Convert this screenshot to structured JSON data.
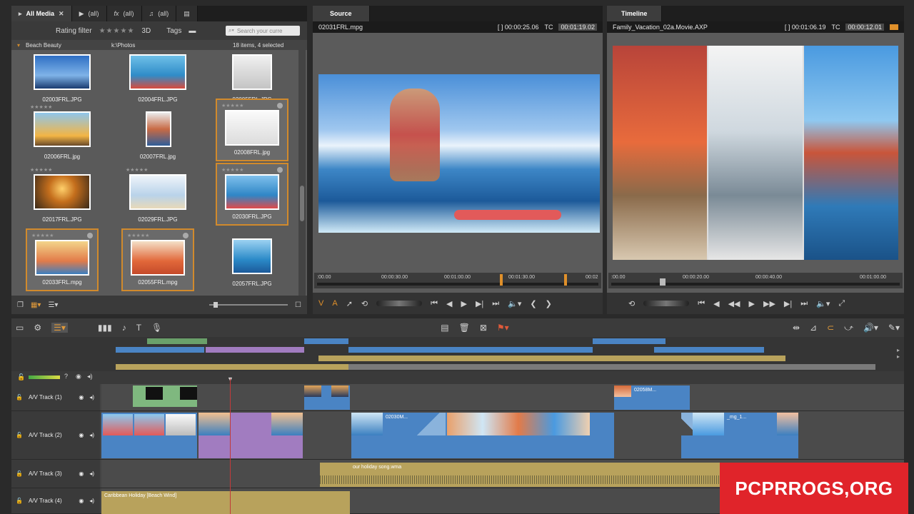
{
  "library": {
    "tabs": [
      "All Media",
      "(all)",
      "(all)",
      "(all)"
    ],
    "filter": {
      "rating_label": "Rating filter",
      "view_3d": "3D",
      "tags_label": "Tags",
      "search_placeholder": "Search your curre"
    },
    "album": {
      "name": "Beach Beauty",
      "path": "k:\\Photos",
      "count": "18 items, 4 selected"
    },
    "items": [
      {
        "name": "02003FRL.JPG",
        "selected": false
      },
      {
        "name": "02004FRL.JPG",
        "selected": false
      },
      {
        "name": "02005FRL.JPG",
        "selected": false
      },
      {
        "name": "02006FRL.jpg",
        "selected": false
      },
      {
        "name": "02007FRL.jpg",
        "selected": false
      },
      {
        "name": "02008FRL.jpg",
        "selected": true
      },
      {
        "name": "02017FRL.JPG",
        "selected": false
      },
      {
        "name": "02029FRL.JPG",
        "selected": false
      },
      {
        "name": "02030FRL.JPG",
        "selected": true
      },
      {
        "name": "02033FRL.mpg",
        "selected": true
      },
      {
        "name": "02055FRL.mpg",
        "selected": true
      },
      {
        "name": "02057FRL.JPG",
        "selected": false
      }
    ]
  },
  "source": {
    "tab": "Source",
    "file": "02031FRL.mpg",
    "duration": "[ ] 00:00:25.06",
    "tc_label": "TC",
    "tc": "00:01:19.02",
    "ruler": [
      ":00.00",
      "00:00:30.00",
      "00:01:00.00",
      "00:01:30.00",
      "00:02"
    ]
  },
  "timeline_monitor": {
    "tab": "Timeline",
    "file": "Family_Vacation_02a.Movie.AXP",
    "duration": "[ ] 00:01:06.19",
    "tc_label": "TC",
    "tc": "00:00:12.01",
    "ruler": [
      ":00.00",
      "00:00:20.00",
      "00:00:40.00",
      "00:01:00.00"
    ]
  },
  "tracks": [
    {
      "name": "A/V Track (1)"
    },
    {
      "name": "A/V Track (2)"
    },
    {
      "name": "A/V Track (3)"
    },
    {
      "name": "A/V Track (4)"
    }
  ],
  "clips": {
    "t1_label": "02058M...",
    "t2_label_a": "02030M...",
    "t2_label_b": "_mg_1...",
    "t3_audio": "our holiday song.wma",
    "t4_audio": "Caribbean Holiday [Beach Wind]"
  },
  "watermark": "PCPRROGS,ORG",
  "colors": {
    "selection": "#d18a2c",
    "video_clip": "#4a84c4",
    "audio_clip": "#b8a25c",
    "title_clip": "#a17cc0",
    "watermark": "#e0242a"
  }
}
